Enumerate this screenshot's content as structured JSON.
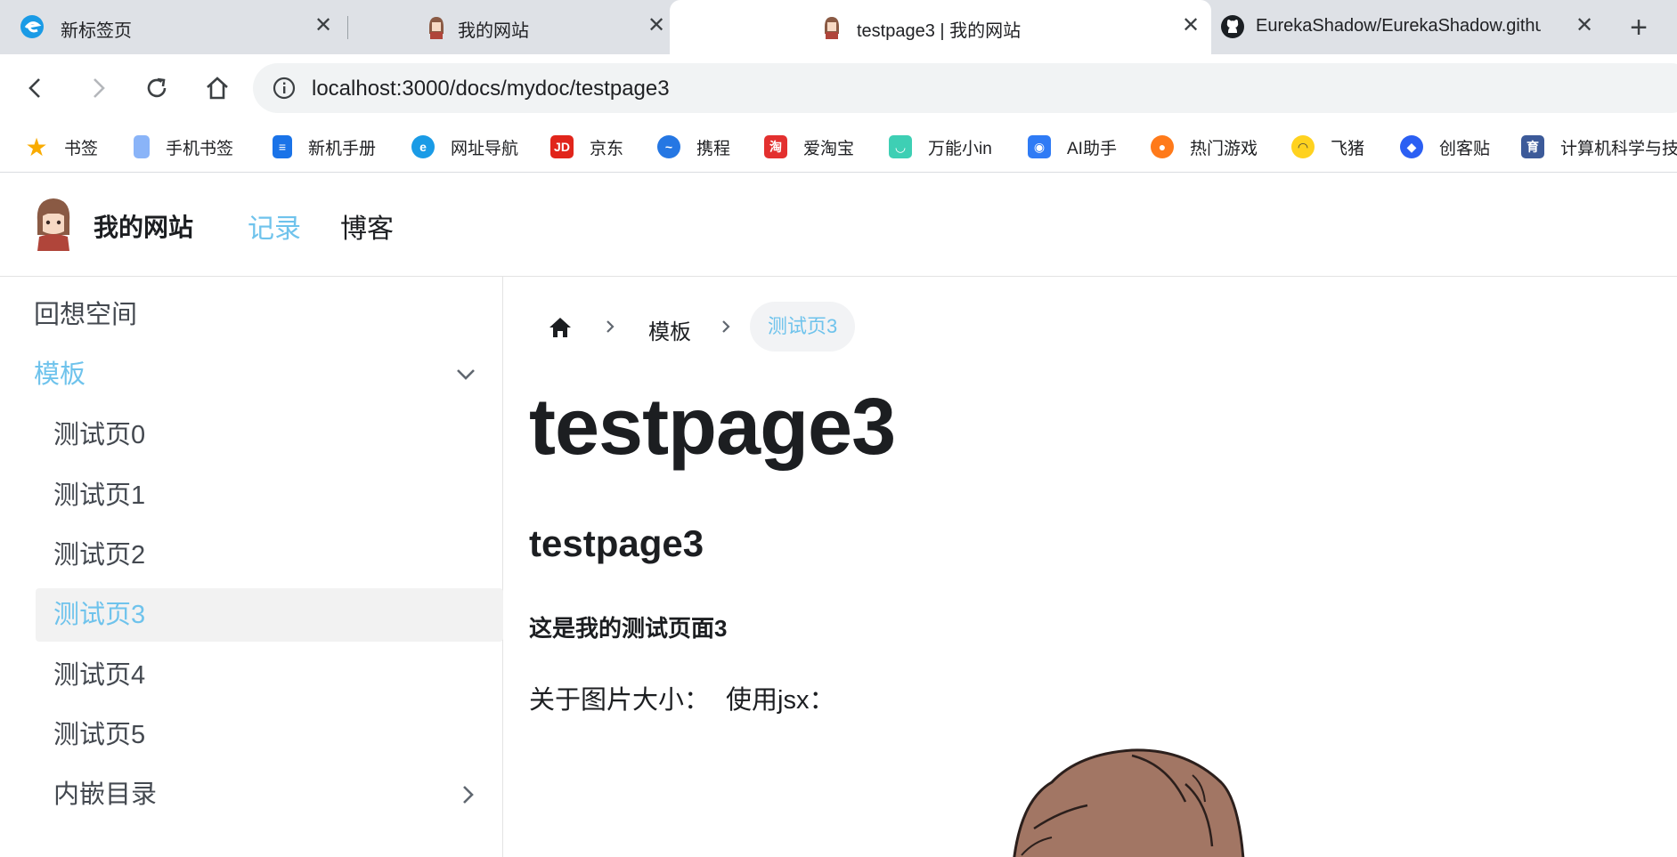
{
  "browser": {
    "tabs": [
      {
        "title": "新标签页",
        "icon": "browser-logo-icon"
      },
      {
        "title": "我的网站",
        "icon": "avatar-icon"
      },
      {
        "title": "testpage3 | 我的网站",
        "icon": "avatar-icon",
        "active": true
      },
      {
        "title": "EurekaShadow/EurekaShadow.github",
        "icon": "github-icon"
      }
    ],
    "new_tab_label": "+",
    "close_glyph": "✕",
    "url": "localhost:3000/docs/mydoc/testpage3",
    "bookmarks": [
      {
        "label": "书签",
        "icon": "star-icon",
        "color": "#f9ab00"
      },
      {
        "label": "手机书签",
        "icon": "phone-icon",
        "color": "#8ab4f8"
      },
      {
        "label": "新机手册",
        "icon": "manual-icon",
        "color": "#1a73e8"
      },
      {
        "label": "网址导航",
        "icon": "browser-logo-icon",
        "color": "#1a9be6"
      },
      {
        "label": "京东",
        "icon": "jd-icon",
        "color": "#e1251b",
        "glyph": "JD"
      },
      {
        "label": "携程",
        "icon": "ctrip-icon",
        "color": "#2577e3"
      },
      {
        "label": "爱淘宝",
        "icon": "taobao-icon",
        "color": "#e3302f",
        "glyph": "淘"
      },
      {
        "label": "万能小in",
        "icon": "robot-icon",
        "color": "#3ecfb4"
      },
      {
        "label": "AI助手",
        "icon": "ai-assistant-icon",
        "color": "#2f7bf5"
      },
      {
        "label": "热门游戏",
        "icon": "game-icon",
        "color": "#ff7a1a"
      },
      {
        "label": "飞猪",
        "icon": "fliggy-icon",
        "color": "#ffd21f"
      },
      {
        "label": "创客贴",
        "icon": "chuangkit-icon",
        "color": "#2b5ff3"
      },
      {
        "label": "计算机科学与技",
        "icon": "book-icon",
        "color": "#3c5a99",
        "glyph": "育"
      }
    ]
  },
  "site": {
    "brand": "我的网站",
    "nav": [
      {
        "label": "记录",
        "active": true
      },
      {
        "label": "博客",
        "active": false
      }
    ],
    "accent": "#6fc3ec"
  },
  "sidebar": {
    "items": [
      {
        "label": "回想空间",
        "level": 0
      },
      {
        "label": "模板",
        "level": 0,
        "category": true,
        "expanded": true
      },
      {
        "label": "测试页0",
        "level": 1
      },
      {
        "label": "测试页1",
        "level": 1
      },
      {
        "label": "测试页2",
        "level": 1
      },
      {
        "label": "测试页3",
        "level": 1,
        "current": true
      },
      {
        "label": "测试页4",
        "level": 1
      },
      {
        "label": "测试页5",
        "level": 1
      },
      {
        "label": "内嵌目录",
        "level": 1,
        "collapsed": true
      }
    ]
  },
  "breadcrumb": {
    "items": [
      "模板",
      "测试页3"
    ]
  },
  "content": {
    "title": "testpage3",
    "heading": "testpage3",
    "bold_line": "这是我的测试页面3",
    "para_part1": "关于图片大小：",
    "para_part2": "使用jsx："
  }
}
